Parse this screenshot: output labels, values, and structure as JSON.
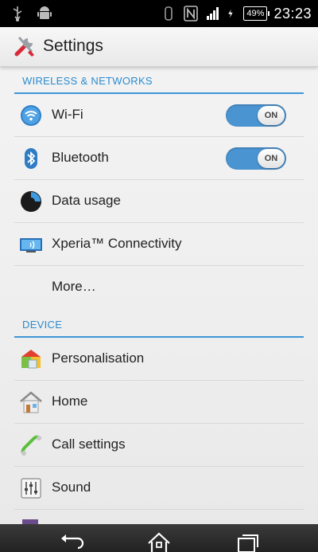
{
  "status_bar": {
    "icons_left": [
      "usb-icon",
      "android-icon"
    ],
    "icons_right": [
      "vibrate-icon",
      "nfc-icon",
      "signal-icon",
      "charging-icon"
    ],
    "battery": "49%",
    "time": "23:23"
  },
  "action_bar": {
    "icon": "tools-icon",
    "title": "Settings"
  },
  "sections": [
    {
      "header": "WIRELESS & NETWORKS",
      "items": [
        {
          "label": "Wi-Fi",
          "icon": "wifi-icon",
          "toggle": "ON"
        },
        {
          "label": "Bluetooth",
          "icon": "bluetooth-icon",
          "toggle": "ON"
        },
        {
          "label": "Data usage",
          "icon": "data-usage-icon"
        },
        {
          "label": "Xperia™ Connectivity",
          "icon": "xperia-connectivity-icon"
        },
        {
          "label": "More…"
        }
      ]
    },
    {
      "header": "DEVICE",
      "items": [
        {
          "label": "Personalisation",
          "icon": "personalisation-icon"
        },
        {
          "label": "Home",
          "icon": "home-icon"
        },
        {
          "label": "Call settings",
          "icon": "phone-icon"
        },
        {
          "label": "Sound",
          "icon": "sound-icon"
        }
      ]
    }
  ],
  "nav_bar": {
    "buttons": [
      "back-icon",
      "home-icon",
      "recents-icon"
    ]
  },
  "colors": {
    "accent": "#3d96d6",
    "toggle_on": "#4a94d2",
    "status_bar_bg": "#000000"
  }
}
